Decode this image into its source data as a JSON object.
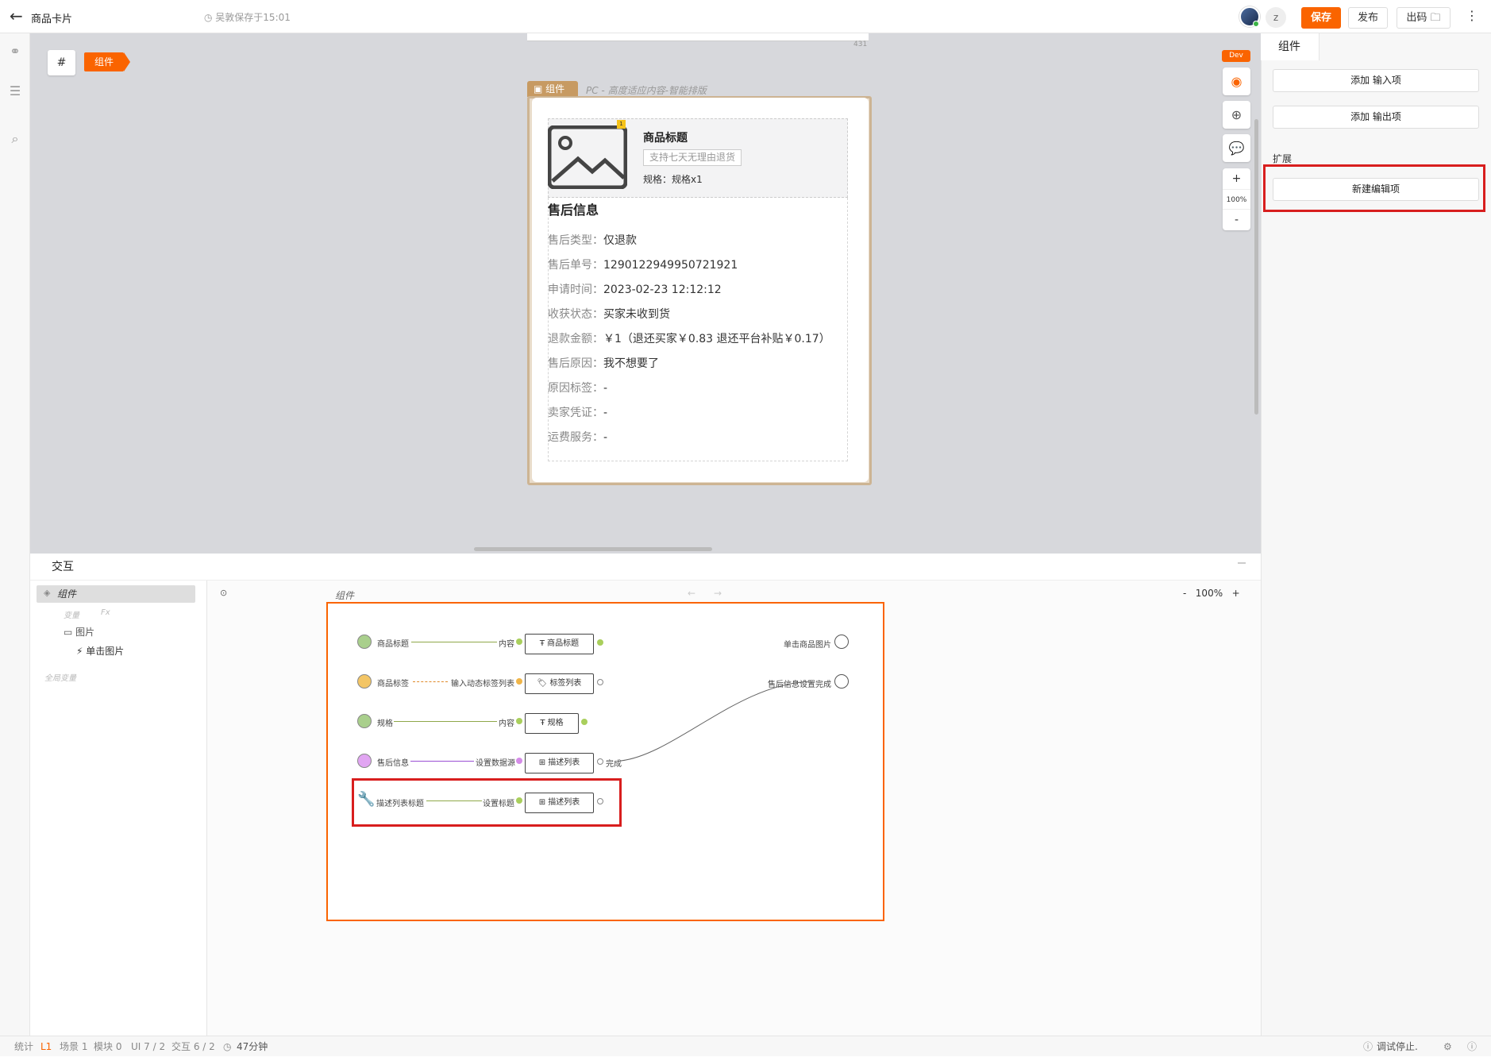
{
  "topbar": {
    "back_icon": "arrow-left-icon",
    "title": "商品卡片",
    "autosave": "吴敦保存于15:01",
    "user_initial": "z",
    "save": "保存",
    "publish": "发布",
    "export_code": "出码",
    "more": "⋮"
  },
  "canvas": {
    "hash_button": "#",
    "breadcrumb": "组件",
    "ruler_number": "431",
    "component_tag": "组件",
    "component_subtitle": "PC - 高度适应内容-智能排版",
    "dev_badge": "Dev",
    "zoom_plus": "+",
    "zoom_level": "100%",
    "zoom_minus": "-",
    "card": {
      "badge": "1",
      "product_title": "商品标题",
      "product_tag": "支持七天无理由退货",
      "product_spec": "规格：规格x1",
      "after_sale_title": "售后信息",
      "rows": [
        {
          "k": "售后类型：",
          "v": "仅退款"
        },
        {
          "k": "售后单号：",
          "v": "1290122949950721921"
        },
        {
          "k": "申请时间：",
          "v": "2023-02-23 12:12:12"
        },
        {
          "k": "收获状态：",
          "v": "买家未收到货"
        },
        {
          "k": "退款金额：",
          "v": "￥1（退还买家￥0.83 退还平台补贴￥0.17）"
        },
        {
          "k": "售后原因：",
          "v": "我不想要了"
        },
        {
          "k": "原因标签：",
          "v": "-"
        },
        {
          "k": "卖家凭证：",
          "v": "-"
        },
        {
          "k": "运费服务：",
          "v": "-"
        }
      ]
    }
  },
  "right_panel": {
    "tab": "组件",
    "add_input": "添加 输入项",
    "add_output": "添加 输出项",
    "extend_label": "扩展",
    "new_edit_item": "新建编辑项"
  },
  "interaction": {
    "title": "交互",
    "tree": {
      "component": "组件",
      "variable": "变量",
      "fx": "Fx",
      "image": "图片",
      "click_image": "单击图片",
      "global_var": "全局变量"
    },
    "graph_title": "组件",
    "zoom": "100%",
    "zoom_minus": "-",
    "zoom_plus": "+",
    "rows": [
      {
        "input": "商品标题",
        "target": "内容",
        "node": "商品标题",
        "node_icon": "T"
      },
      {
        "input": "商品标签",
        "target": "输入动态标签列表",
        "node": "标签列表",
        "node_icon": "tag-icon"
      },
      {
        "input": "规格",
        "target": "内容",
        "node": "规格",
        "node_icon": "T"
      },
      {
        "input": "售后信息",
        "target": "设置数据源",
        "node": "描述列表",
        "node_icon": "list-icon",
        "output": "完成"
      },
      {
        "input": "描述列表标题",
        "target": "设置标题",
        "node": "描述列表",
        "node_icon": "list-icon"
      }
    ],
    "outputs": [
      "单击商品图片",
      "售后信息设置完成"
    ],
    "colors": {
      "green": "#8fc06a",
      "yellow": "#f0b548",
      "purple": "#d58ce8",
      "orange_accent": "#fa6400",
      "highlight_red": "#d81e1e"
    }
  },
  "status": {
    "stats": "统计",
    "level": "L1",
    "scene": "场景 1",
    "module": "模块 0",
    "ui": "UI 7 / 2",
    "interact": "交互 6 / 2",
    "time": "47分钟",
    "debug": "调试停止."
  }
}
